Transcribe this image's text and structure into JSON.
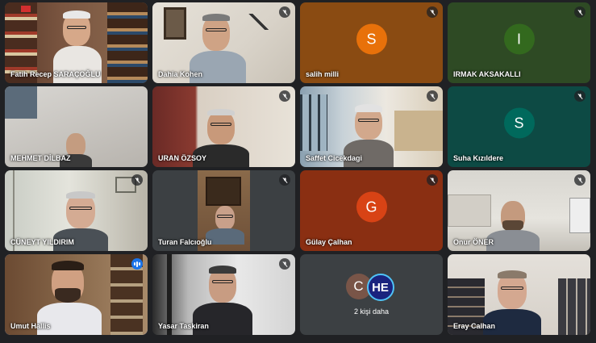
{
  "participants": [
    {
      "name": "Fatih Recep SARAÇOĞLU"
    },
    {
      "name": "Dahia Kohen"
    },
    {
      "name": "salih milli",
      "initial": "S",
      "avatar_color": "#e8710a"
    },
    {
      "name": "IRMAK AKSAKALLI",
      "initial": "I",
      "avatar_color": "#33691e"
    },
    {
      "name": "MEHMET DİLBAZ"
    },
    {
      "name": "URAN ÖZSOY"
    },
    {
      "name": "Saffet Cicekdagi"
    },
    {
      "name": "Suha Kızıldere",
      "initial": "S",
      "avatar_color": "#00695c"
    },
    {
      "name": "CÜNEYT YILDIRIM"
    },
    {
      "name": "Turan Falcıoğlu"
    },
    {
      "name": "Gülay Çalhan",
      "initial": "G",
      "avatar_color": "#d84315"
    },
    {
      "name": "Onur ÖNER"
    },
    {
      "name": "Umut Hallis"
    },
    {
      "name": "Yasar Taskiran"
    },
    {
      "name": "Eray Calhan"
    }
  ],
  "overflow": {
    "label": "2 kişi daha",
    "avatar1_initial": "C",
    "avatar2_initial": "HE"
  },
  "colors": {
    "background": "#202124",
    "tile_background": "#3c4043",
    "speaking_outline": "#8ab4f8"
  },
  "icons": {
    "muted": "mic-off-icon",
    "speaking": "audio-level-icon"
  }
}
